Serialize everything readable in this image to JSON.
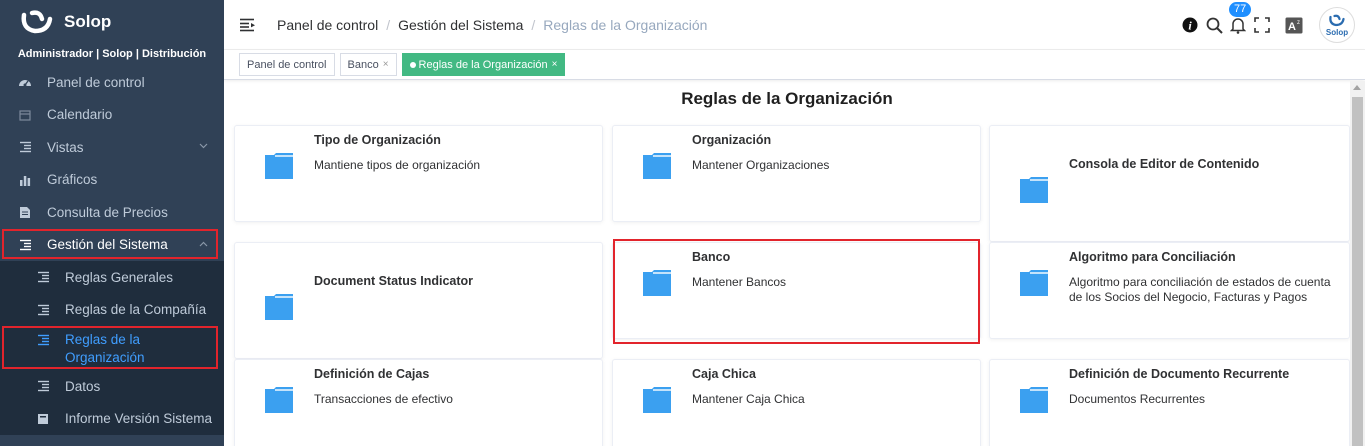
{
  "sidebar": {
    "brand": "Solop",
    "user_line": "Administrador | Solop | Distribución",
    "items": [
      {
        "label": "Panel de control",
        "icon": "dashboard-icon"
      },
      {
        "label": "Calendario",
        "icon": "calendar-icon"
      },
      {
        "label": "Vistas",
        "icon": "tree-table-icon"
      },
      {
        "label": "Gráficos",
        "icon": "bar-chart-icon"
      },
      {
        "label": "Consulta de Precios",
        "icon": "price-document-icon"
      },
      {
        "label": "Gestión del Sistema",
        "icon": "tree-table-icon"
      }
    ],
    "subitems": [
      {
        "label": "Reglas Generales",
        "icon": "tree-table-icon"
      },
      {
        "label": "Reglas de la Compañía",
        "icon": "tree-table-icon"
      },
      {
        "label": "Reglas de la Organización",
        "icon": "tree-table-icon"
      },
      {
        "label": "Datos",
        "icon": "tree-table-icon"
      },
      {
        "label": "Informe Versión Sistema",
        "icon": "report-icon"
      }
    ],
    "colors": {
      "background": "#304156",
      "active": "#409eff",
      "highlight_border": "#e2242c"
    }
  },
  "navbar": {
    "breadcrumb": [
      "Panel de control",
      "Gestión del Sistema",
      "Reglas de la Organización"
    ],
    "notification_count": "77",
    "avatar_label": "Solop",
    "icons": [
      "info-icon",
      "search-icon",
      "bell-icon",
      "fullscreen-icon",
      "language-icon"
    ]
  },
  "tags": [
    {
      "label": "Panel de control",
      "closable": false
    },
    {
      "label": "Banco",
      "closable": true
    },
    {
      "label": "Reglas de la Organización",
      "closable": true,
      "active": true
    }
  ],
  "main": {
    "title": "Reglas de la Organización",
    "cards": [
      {
        "title": "Tipo de Organización",
        "desc": "Mantiene tipos de organización"
      },
      {
        "title": "Organización",
        "desc": "Mantener Organizaciones"
      },
      {
        "title": "Consola de Editor de Contenido",
        "desc": ""
      },
      {
        "title": "Document Status Indicator",
        "desc": ""
      },
      {
        "title": "Banco",
        "desc": "Mantener Bancos"
      },
      {
        "title": "Algoritmo para Conciliación",
        "desc": "Algoritmo para conciliación de estados de cuenta de los Socios del Negocio, Facturas y Pagos"
      },
      {
        "title": "Definición de Cajas",
        "desc": "Transacciones de efectivo"
      },
      {
        "title": "Caja Chica",
        "desc": "Mantener Caja Chica"
      },
      {
        "title": "Definición de Documento Recurrente",
        "desc": "Documentos Recurrentes"
      }
    ],
    "folder_color": "#3ba0f0"
  }
}
